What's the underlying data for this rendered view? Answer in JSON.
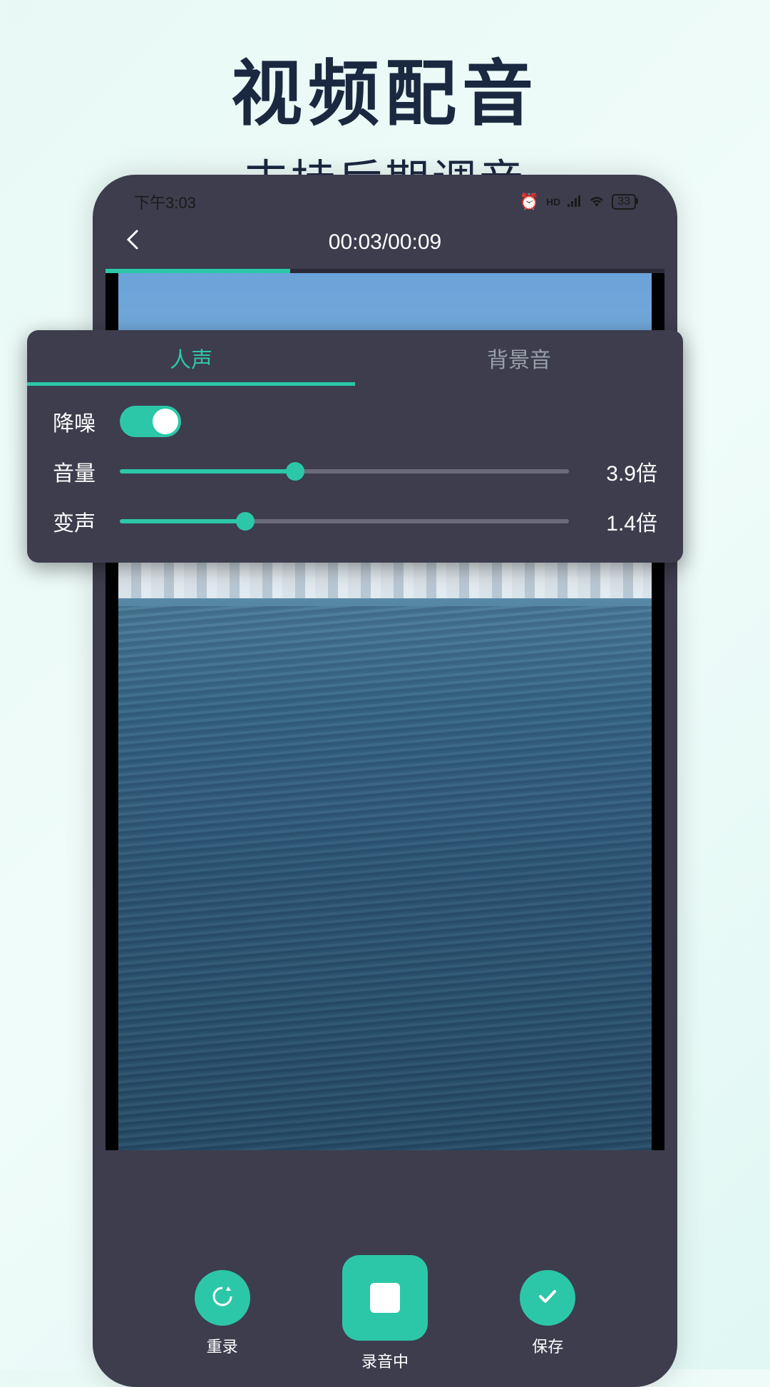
{
  "promo": {
    "title": "视频配音",
    "subtitle": "支持后期调音"
  },
  "status_bar": {
    "time": "下午3:03",
    "battery": "33"
  },
  "header": {
    "timer": "00:03/00:09"
  },
  "progress_percent": 33,
  "audio_panel": {
    "tabs": {
      "voice": "人声",
      "bgm": "背景音"
    },
    "rows": {
      "noise_reduction_label": "降噪",
      "noise_reduction_on": true,
      "volume_label": "音量",
      "volume_value": "3.9倍",
      "volume_percent": 39,
      "pitch_label": "变声",
      "pitch_value": "1.4倍",
      "pitch_percent": 28
    }
  },
  "controls": {
    "rerecord": "重录",
    "recording": "录音中",
    "save": "保存"
  }
}
